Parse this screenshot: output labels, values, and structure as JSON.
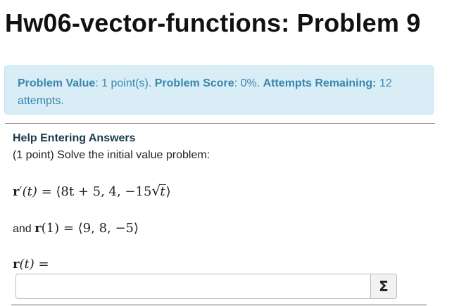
{
  "header": {
    "title": "Hw06-vector-functions: Problem 9"
  },
  "status": {
    "value_label": "Problem Value",
    "value_text": ": 1 point(s). ",
    "score_label": "Problem Score",
    "score_text": ": 0%. ",
    "attempts_label": "Attempts Remaining:",
    "attempts_text": " 12 attempts."
  },
  "problem": {
    "help_link": "Help Entering Answers",
    "prompt": "(1 point) Solve the initial value problem:",
    "eq1": {
      "lhs_r": "r",
      "lhs_prime": "′",
      "lhs_arg": "(t)",
      "equals": " = ",
      "open": "⟨",
      "comp1": "8t + 5, 4, −15",
      "sqrt_arg": "t",
      "close": "⟩"
    },
    "eq2": {
      "prefix": "and ",
      "r": "r",
      "arg": "(1)",
      "equals": " = ",
      "value": "⟨9, 8, −5⟩"
    },
    "eq3": {
      "r": "r",
      "arg": "(t)",
      "equals": " ="
    },
    "answer": {
      "value": "",
      "placeholder": ""
    },
    "equation_button": "Σ"
  }
}
